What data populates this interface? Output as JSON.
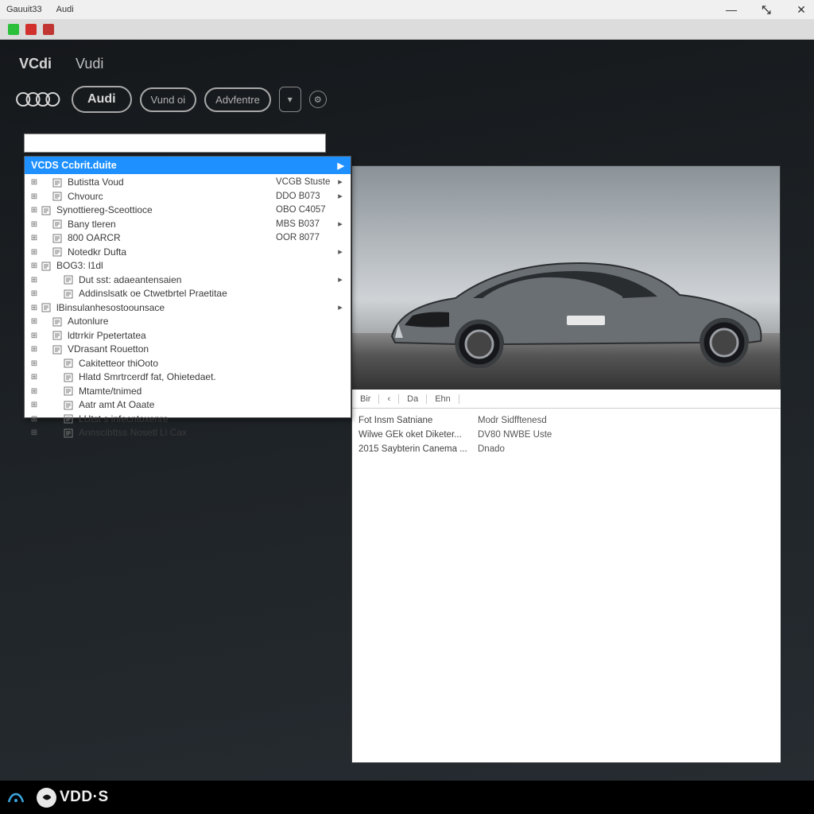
{
  "titlebar": {
    "left1": "Gauuit33",
    "left2": "Audi"
  },
  "tabs": {
    "t1": "VCdi",
    "t2": "Vudi"
  },
  "buttons": {
    "audi": "Audi",
    "vund": "Vund oi",
    "adventure": "Advfentre",
    "dropdown_glyph": "▾"
  },
  "dropdown": {
    "header_label": "VCDS Ccbrit.duite",
    "items": [
      {
        "indent": 1,
        "label": "Butistta Voud",
        "code": "VCGB Stuste",
        "chev": true
      },
      {
        "indent": 1,
        "label": "Chvourc",
        "code": "DDO B073",
        "chev": true
      },
      {
        "indent": 0,
        "label": "Synottiereg-Sceottioce",
        "code": "OBO C4057",
        "chev": false
      },
      {
        "indent": 1,
        "label": "Bany tleren",
        "code": "MBS B037",
        "chev": true
      },
      {
        "indent": 1,
        "label": "800 OARCR",
        "code": "OOR 8077",
        "chev": false
      },
      {
        "indent": 1,
        "label": "Notedkr Dufta",
        "code": "",
        "chev": true
      },
      {
        "indent": 0,
        "label": "BOG3: l1dl",
        "code": "",
        "chev": false
      },
      {
        "indent": 2,
        "label": "Dut sst: adaeantensaien",
        "code": "",
        "chev": true
      },
      {
        "indent": 2,
        "label": "Addinslsatk oe Ctwetbrtel Praetitae",
        "code": "",
        "chev": false
      },
      {
        "indent": 0,
        "label": "lBinsulanhesostoounsace",
        "code": "",
        "chev": true
      },
      {
        "indent": 1,
        "label": "Autonlure",
        "code": "",
        "chev": false
      },
      {
        "indent": 1,
        "label": "ldtrrkir Ppetertatea",
        "code": "",
        "chev": false
      },
      {
        "indent": 1,
        "label": "VDrasant Rouetton",
        "code": "",
        "chev": false
      },
      {
        "indent": 2,
        "label": "Cakitetteor thiOoto",
        "code": "",
        "chev": false
      },
      {
        "indent": 2,
        "label": "Hlatd Smrtrcerdf fat, Ohietedaet.",
        "code": "",
        "chev": false
      },
      {
        "indent": 2,
        "label": "Mtamte/tnimed",
        "code": "",
        "chev": false
      },
      {
        "indent": 2,
        "label": "Aatr amt At Oaate",
        "code": "",
        "chev": false
      },
      {
        "indent": 2,
        "label": "LUtst s infecntoxenre",
        "code": "",
        "chev": false
      },
      {
        "indent": 2,
        "label": "Annscibttss Nosetl Li Cax",
        "code": "",
        "chev": false
      }
    ]
  },
  "right_panel": {
    "tabs": [
      "Bir",
      "‹",
      "Da",
      "Ehn"
    ],
    "rows": [
      {
        "lbl": "Fot Insm Satniane",
        "val": "Modr Sidfftenesd"
      },
      {
        "lbl": "Wilwe GEk oket Diketer...",
        "val": "DV80 NWBE Uste"
      },
      {
        "lbl": "2015 Saybterin Canema ...",
        "val": "Dnado"
      }
    ]
  },
  "taskbar": {
    "logo_text": "VDD·S"
  }
}
